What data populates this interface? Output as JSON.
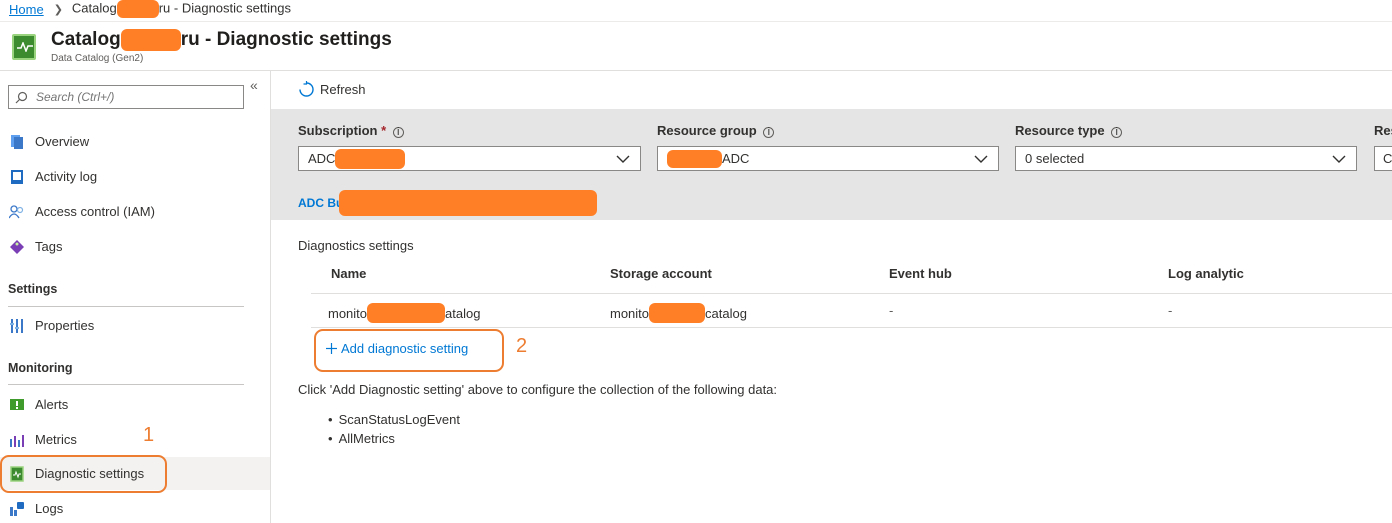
{
  "breadcrumb": {
    "home": "Home",
    "current_prefix": "Catalog",
    "current_suffix": "ru - Diagnostic settings"
  },
  "header": {
    "title_prefix": "Catalog",
    "title_suffix": "ru - Diagnostic settings",
    "subtitle": "Data Catalog (Gen2)"
  },
  "sidebar": {
    "search_placeholder": "Search (Ctrl+/)",
    "collapse_glyph": "«",
    "items_top": [
      {
        "label": "Overview",
        "icon": "overview-icon"
      },
      {
        "label": "Activity log",
        "icon": "activity-log-icon"
      },
      {
        "label": "Access control (IAM)",
        "icon": "people-icon"
      },
      {
        "label": "Tags",
        "icon": "tag-icon"
      }
    ],
    "settings_label": "Settings",
    "settings_items": [
      {
        "label": "Properties",
        "icon": "properties-icon"
      }
    ],
    "monitoring_label": "Monitoring",
    "monitoring_items": [
      {
        "label": "Alerts",
        "icon": "alert-icon"
      },
      {
        "label": "Metrics",
        "icon": "metrics-icon"
      },
      {
        "label": "Diagnostic settings",
        "icon": "diagnostic-icon",
        "selected": true
      },
      {
        "label": "Logs",
        "icon": "logs-icon"
      }
    ]
  },
  "annotations": {
    "one": "1",
    "two": "2"
  },
  "toolbar": {
    "refresh_label": "Refresh"
  },
  "filters": {
    "subscription": {
      "label": "Subscription",
      "required": "*",
      "value_prefix": "ADC"
    },
    "resource_group": {
      "label": "Resource group",
      "value_suffix": "ADC"
    },
    "resource_type": {
      "label": "Resource type",
      "value": "0 selected"
    },
    "resource": {
      "label": "Res",
      "value": "C"
    },
    "subscription_link_prefix": "ADC Bu",
    "info_glyph": "i"
  },
  "diagnostics": {
    "title": "Diagnostics settings",
    "columns": [
      "Name",
      "Storage account",
      "Event hub",
      "Log analytic"
    ],
    "row": {
      "name_prefix": "monito",
      "name_suffix": "atalog",
      "storage_prefix": "monito",
      "storage_suffix": "catalog",
      "event_hub": "-",
      "log_analytic": "-"
    },
    "add_label": "Add diagnostic setting",
    "help_text": "Click 'Add Diagnostic setting' above to configure the collection of the following data:",
    "data_items": [
      "ScanStatusLogEvent",
      "AllMetrics"
    ]
  },
  "colors": {
    "accent": "#0078d4",
    "annotation": "#ed7d31",
    "redaction": "#ff7f27"
  }
}
